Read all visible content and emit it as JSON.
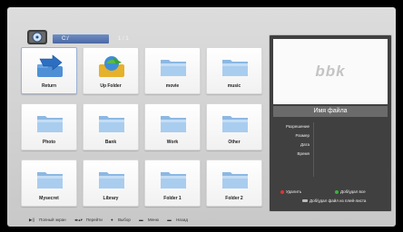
{
  "header": {
    "path": "C:/",
    "page_counter": "1 / 1"
  },
  "grid": {
    "items": [
      {
        "label": "Return",
        "icon": "return-arrow-icon"
      },
      {
        "label": "Up Folder",
        "icon": "up-folder-icon"
      },
      {
        "label": "movie",
        "icon": "folder-icon"
      },
      {
        "label": "music",
        "icon": "folder-icon"
      },
      {
        "label": "Photo",
        "icon": "folder-icon"
      },
      {
        "label": "Bank",
        "icon": "folder-icon"
      },
      {
        "label": "Work",
        "icon": "folder-icon"
      },
      {
        "label": "Other",
        "icon": "folder-icon"
      },
      {
        "label": "Mysecret",
        "icon": "folder-icon"
      },
      {
        "label": "Library",
        "icon": "folder-icon"
      },
      {
        "label": "Folder 1",
        "icon": "folder-icon"
      },
      {
        "label": "Folder 2",
        "icon": "folder-icon"
      }
    ]
  },
  "panel": {
    "brand": "bbk",
    "file_name": "Имя файла",
    "info_labels": [
      "Разрешение",
      "Размер",
      "Дата",
      "Время"
    ],
    "legend": {
      "delete": "Удалить",
      "add_remove_all": "Доб/удал все",
      "add_remove_playlist": "Доб/удал файл из плей-листа"
    }
  },
  "footer": {
    "fullscreen": "Полный экран",
    "navigate": "Перейти",
    "select": "Выбор",
    "menu": "Меню",
    "back": "Назад"
  },
  "colors": {
    "delete_key": "#e2332f",
    "add_all_key": "#35b53a",
    "path_bar": "#5676b3",
    "panel_bg": "#404040"
  }
}
